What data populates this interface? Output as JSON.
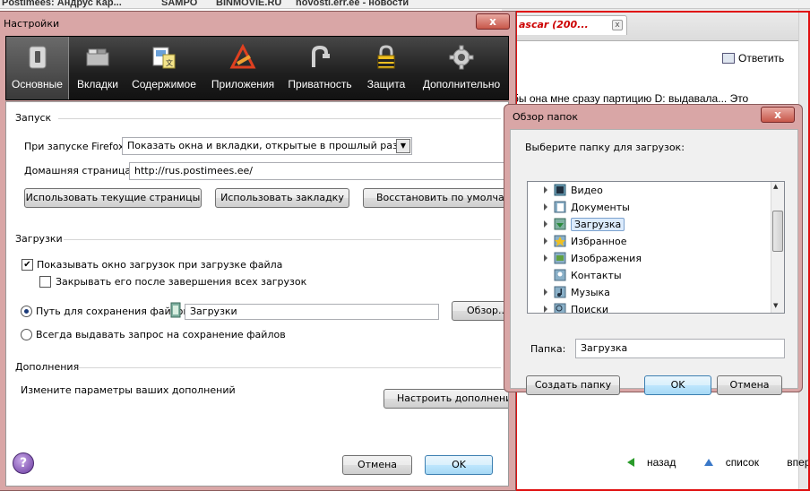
{
  "colors": {
    "window_frame": "#d9a6a6",
    "toolbar_dark": "#1e1e1e",
    "selection": "#dcebfc",
    "link_green": "#2a9b2a",
    "bg_tab_title": "#cc0000"
  },
  "background": {
    "top_links": [
      "Postimees: Андрус Кар...",
      "SAMPO",
      "BINMOVIE.RU",
      "novosti.err.ee - новости"
    ],
    "tab_title": "ascar (200...",
    "reply_label": "Ответить",
    "snippet_text": "бы она мне сразу партицию D: выдавала... Это",
    "nav": {
      "back": "назад",
      "list": "список",
      "forward": "вперед"
    }
  },
  "settings": {
    "title": "Настройки",
    "close_label": "x",
    "toolbar": [
      {
        "label": "Основные",
        "icon": "switch-icon",
        "active": true
      },
      {
        "label": "Вкладки",
        "icon": "tabs-icon"
      },
      {
        "label": "Содержимое",
        "icon": "content-icon"
      },
      {
        "label": "Приложения",
        "icon": "applications-icon"
      },
      {
        "label": "Приватность",
        "icon": "privacy-mask-icon"
      },
      {
        "label": "Защита",
        "icon": "lock-icon"
      },
      {
        "label": "Дополнительно",
        "icon": "gear-icon"
      }
    ],
    "startup": {
      "section": "Запуск",
      "when_start_label": "При запуске Firefox:",
      "when_start_value": "Показать окна и вкладки, открытые в прошлый раз",
      "home_label": "Домашняя страница:",
      "home_value": "http://rus.postimees.ee/",
      "btn_current": "Использовать текущие страницы",
      "btn_bookmark": "Использовать закладку",
      "btn_restore": "Восстановить по умолчанию"
    },
    "downloads": {
      "section": "Загрузки",
      "show_window": "Показывать окно загрузок при загрузке файла",
      "show_window_checked": true,
      "close_when_done": "Закрывать его после завершения всех загрузок",
      "close_when_done_checked": false,
      "save_path_label": "Путь для сохранения файлов",
      "save_path_value": "Загрузки",
      "save_path_selected": true,
      "browse_btn": "Обзор...",
      "always_ask": "Всегда выдавать запрос на сохранение файлов"
    },
    "addons": {
      "section": "Дополнения",
      "text": "Измените параметры ваших дополнений",
      "btn": "Настроить дополнения"
    },
    "help_label": "?",
    "cancel_label": "Отмена",
    "ok_label": "OK"
  },
  "browse": {
    "title": "Обзор папок",
    "close_label": "x",
    "prompt": "Выберите папку для загрузок:",
    "tree": [
      {
        "label": "Видео",
        "icon": "video-folder-icon",
        "expandable": true
      },
      {
        "label": "Документы",
        "icon": "documents-folder-icon",
        "expandable": true
      },
      {
        "label": "Загрузка",
        "icon": "downloads-folder-icon",
        "expandable": true,
        "selected": true
      },
      {
        "label": "Избранное",
        "icon": "favorites-folder-icon",
        "expandable": true
      },
      {
        "label": "Изображения",
        "icon": "pictures-folder-icon",
        "expandable": true
      },
      {
        "label": "Контакты",
        "icon": "contacts-folder-icon",
        "expandable": false
      },
      {
        "label": "Музыка",
        "icon": "music-folder-icon",
        "expandable": true
      },
      {
        "label": "Поиски",
        "icon": "searches-folder-icon",
        "expandable": true
      }
    ],
    "folder_label": "Папка:",
    "folder_value": "Загрузка",
    "new_folder": "Создать папку",
    "ok": "OK",
    "cancel": "Отмена"
  }
}
